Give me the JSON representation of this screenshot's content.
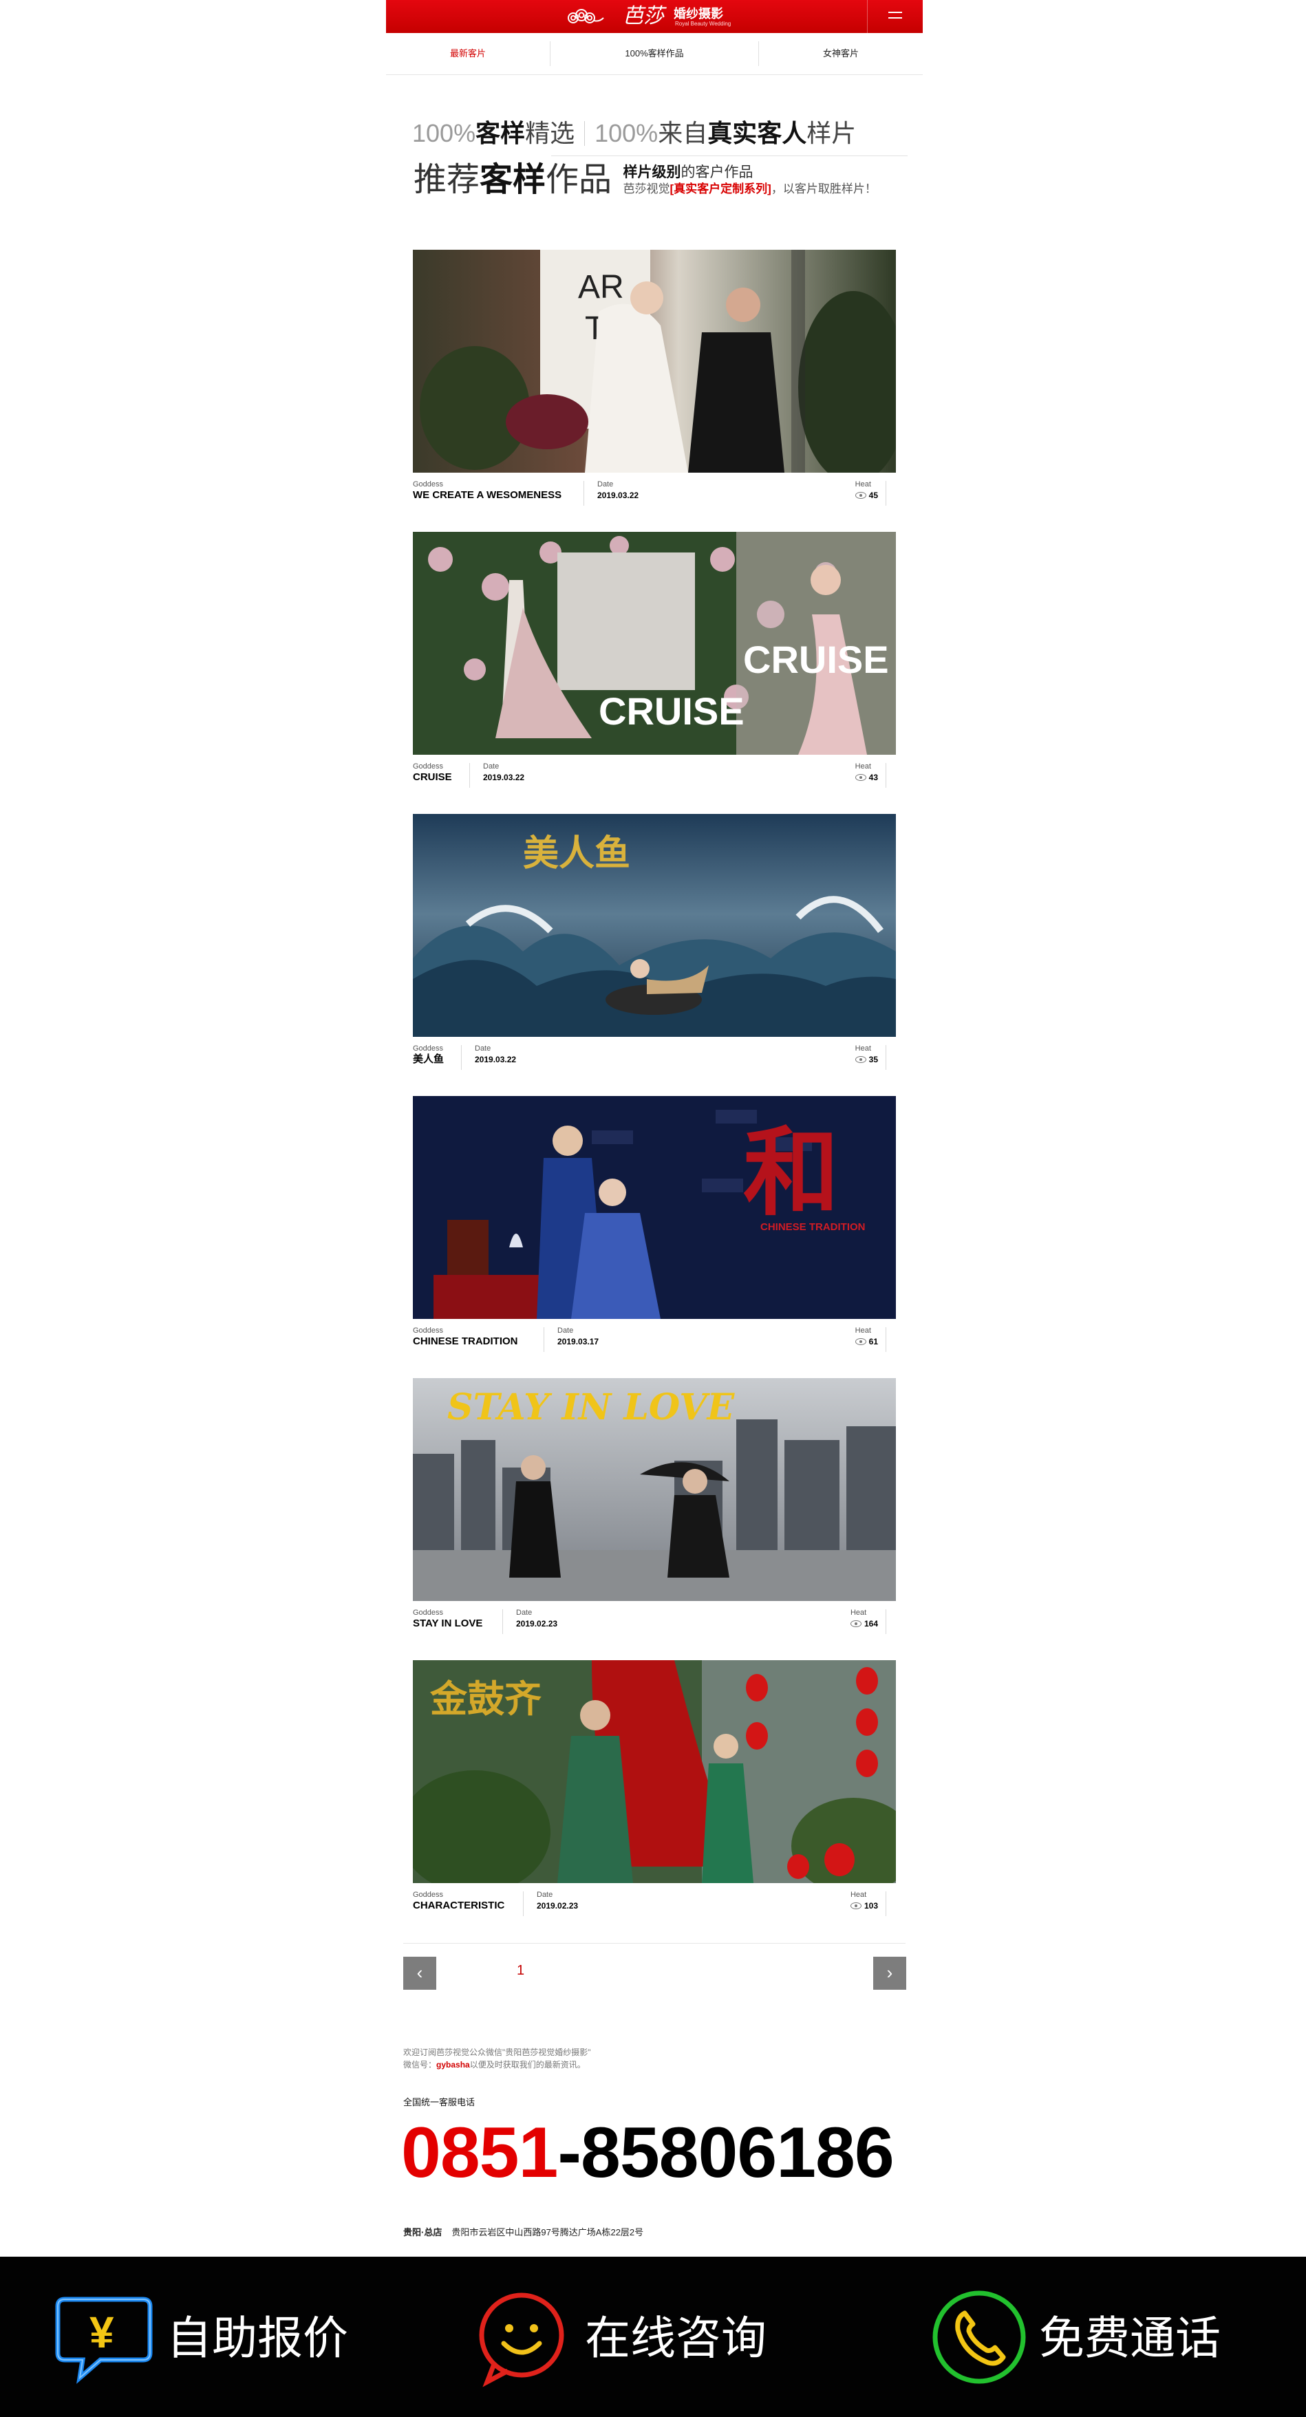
{
  "header": {
    "brand": "芭莎",
    "brand_sub": "婚纱摄影",
    "brand_tagline": "Royal Beauty Wedding"
  },
  "tabs": [
    {
      "label": "最新客片",
      "active": true
    },
    {
      "label": "100%客样作品",
      "active": false
    },
    {
      "label": "女神客片",
      "active": false
    }
  ],
  "heading": {
    "line1_a_gray": "100%",
    "line1_a_bold": "客样",
    "line1_a_norm": "精选",
    "line1_b_gray": "100%",
    "line1_b_norm": "来自",
    "line1_b_bold": "真实客人",
    "line1_b_end": "样片",
    "line2_a": "推荐",
    "line2_bold": "客样",
    "line2_b": "作品",
    "side_bold": "样片级别",
    "side_rest": "的客户作品",
    "side2_a": "芭莎视觉",
    "side2_red": "[真实客户定制系列]",
    "side2_b": "，以客片取胜样片！"
  },
  "meta_labels": {
    "goddess": "Goddess",
    "date": "Date",
    "heat": "Heat"
  },
  "cards": [
    {
      "title": "WE CREATE A WESOMENESS",
      "date": "2019.03.22",
      "heat": "45"
    },
    {
      "title": "CRUISE",
      "date": "2019.03.22",
      "heat": "43",
      "overlay1": "CRUISE",
      "overlay2": "CRUISE"
    },
    {
      "title": "美人鱼",
      "date": "2019.03.22",
      "heat": "35",
      "overlay1": "美人鱼"
    },
    {
      "title": "CHINESE TRADITION",
      "date": "2019.03.17",
      "heat": "61",
      "overlay1": "和",
      "overlay2": "CHINESE TRADITION"
    },
    {
      "title": "STAY IN LOVE",
      "date": "2019.02.23",
      "heat": "164",
      "overlay1": "STAY IN LOVE"
    },
    {
      "title": "CHARACTERISTIC",
      "date": "2019.02.23",
      "heat": "103",
      "overlay1": "金鼓齐"
    }
  ],
  "pager": {
    "page": "1",
    "prev": "‹",
    "next": "›"
  },
  "footer": {
    "welcome1": "欢迎订阅芭莎视觉公众微信\"贵阳芭莎视觉婚纱摄影\"",
    "welcome2_a": "微信号：",
    "welcome2_red": "gybasha",
    "welcome2_b": "以便及时获取我们的最新资讯。",
    "hotline_label": "全国统一客服电话",
    "phone_prefix": "0851",
    "phone_rest": "-85806186",
    "address_label": "贵阳·总店",
    "address": "贵阳市云岩区中山西路97号腾达广场A栋22层2号"
  },
  "bottom_bar": [
    {
      "label": "自助报价",
      "icon": "yuan-chat-icon",
      "color": "#1e90ff"
    },
    {
      "label": "在线咨询",
      "icon": "smile-chat-icon",
      "color": "#e0221b"
    },
    {
      "label": "免费通话",
      "icon": "phone-icon",
      "color": "#22c12e"
    }
  ],
  "colors": {
    "brand_red": "#d20000",
    "bar_black": "#020202"
  }
}
